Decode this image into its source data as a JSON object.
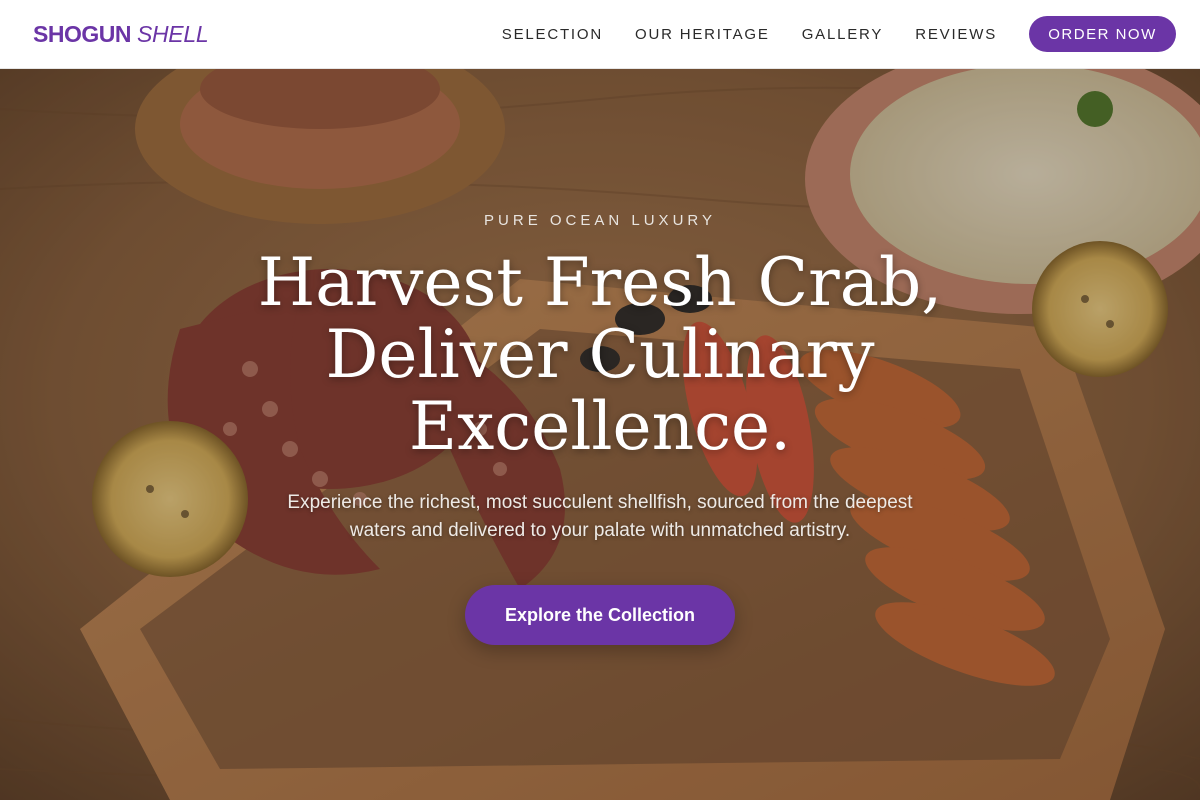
{
  "brand": {
    "main": "SHOGUN",
    "accent": "SHELL",
    "color": "#6b35a6"
  },
  "nav": {
    "items": [
      {
        "label": "SELECTION"
      },
      {
        "label": "OUR HERITAGE"
      },
      {
        "label": "GALLERY"
      },
      {
        "label": "REVIEWS"
      }
    ],
    "cta_label": "ORDER NOW"
  },
  "hero": {
    "eyebrow": "PURE OCEAN LUXURY",
    "headline_lines": [
      "Harvest Fresh Crab,",
      "Deliver Culinary",
      "Excellence."
    ],
    "subtext": "Experience the richest, most succulent shellfish, sourced from the deepest waters and delivered to your palate with unmatched artistry.",
    "cta_label": "Explore the Collection"
  },
  "colors": {
    "accent": "#6b35a6",
    "nav_text": "#2a2a2a"
  }
}
